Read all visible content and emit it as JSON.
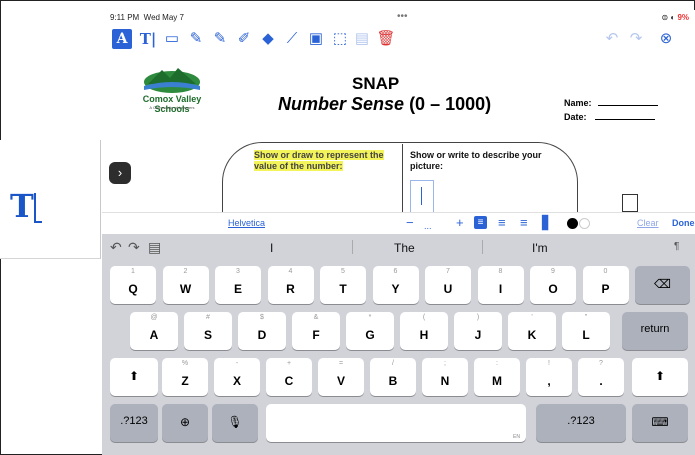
{
  "status": {
    "time": "9:11 PM",
    "date": "Wed May 7",
    "battery": "9%"
  },
  "toolbar": {
    "tools": [
      {
        "name": "text-box-tool",
        "glyph": "A"
      },
      {
        "name": "text-cursor-tool",
        "glyph": "T|"
      },
      {
        "name": "comment-tool",
        "glyph": "💬"
      },
      {
        "name": "pen-tool",
        "glyph": "✎"
      },
      {
        "name": "pencil-tool",
        "glyph": "✎"
      },
      {
        "name": "highlighter-tool",
        "glyph": "✐"
      },
      {
        "name": "eraser-tool",
        "glyph": "⌫"
      },
      {
        "name": "line-tool",
        "glyph": "⁄"
      },
      {
        "name": "image-tool",
        "glyph": "▣"
      },
      {
        "name": "select-tool",
        "glyph": "⬚"
      },
      {
        "name": "trash-tool",
        "glyph": "🗑"
      }
    ]
  },
  "document": {
    "logo_name": "Comox Valley Schools",
    "logo_tag": "A Community of Learners",
    "title": "SNAP",
    "subtitle": "Number Sense",
    "range": "(0 – 1000)",
    "name_label": "Name:",
    "date_label": "Date:",
    "prompt_left": "Show or draw to represent the value of the number:",
    "prompt_right": "Show or write to describe your picture:"
  },
  "format_bar": {
    "font": "Helvetica",
    "minus": "−",
    "plus": "+",
    "clear": "Clear",
    "done": "Done"
  },
  "suggestions": [
    "I",
    "The",
    "I'm"
  ],
  "keyboard": {
    "row1": [
      [
        "1",
        "Q"
      ],
      [
        "2",
        "W"
      ],
      [
        "3",
        "E"
      ],
      [
        "4",
        "R"
      ],
      [
        "5",
        "T"
      ],
      [
        "6",
        "Y"
      ],
      [
        "7",
        "U"
      ],
      [
        "8",
        "I"
      ],
      [
        "9",
        "O"
      ],
      [
        "0",
        "P"
      ]
    ],
    "row2": [
      [
        "@",
        "A"
      ],
      [
        "#",
        "S"
      ],
      [
        "$",
        "D"
      ],
      [
        "&",
        "F"
      ],
      [
        "*",
        "G"
      ],
      [
        "(",
        "H"
      ],
      [
        ")",
        "J"
      ],
      [
        "'",
        "K"
      ],
      [
        "\"",
        "L"
      ]
    ],
    "row3": [
      [
        "%",
        "Z"
      ],
      [
        "-",
        "X"
      ],
      [
        "+",
        "C"
      ],
      [
        "=",
        "V"
      ],
      [
        "/",
        "B"
      ],
      [
        ";",
        "N"
      ],
      [
        ":",
        "M"
      ],
      [
        "!",
        ","
      ],
      [
        "?",
        "."
      ]
    ],
    "return_label": "return",
    "numbers_label": ".?123",
    "lang_label": "EN"
  }
}
